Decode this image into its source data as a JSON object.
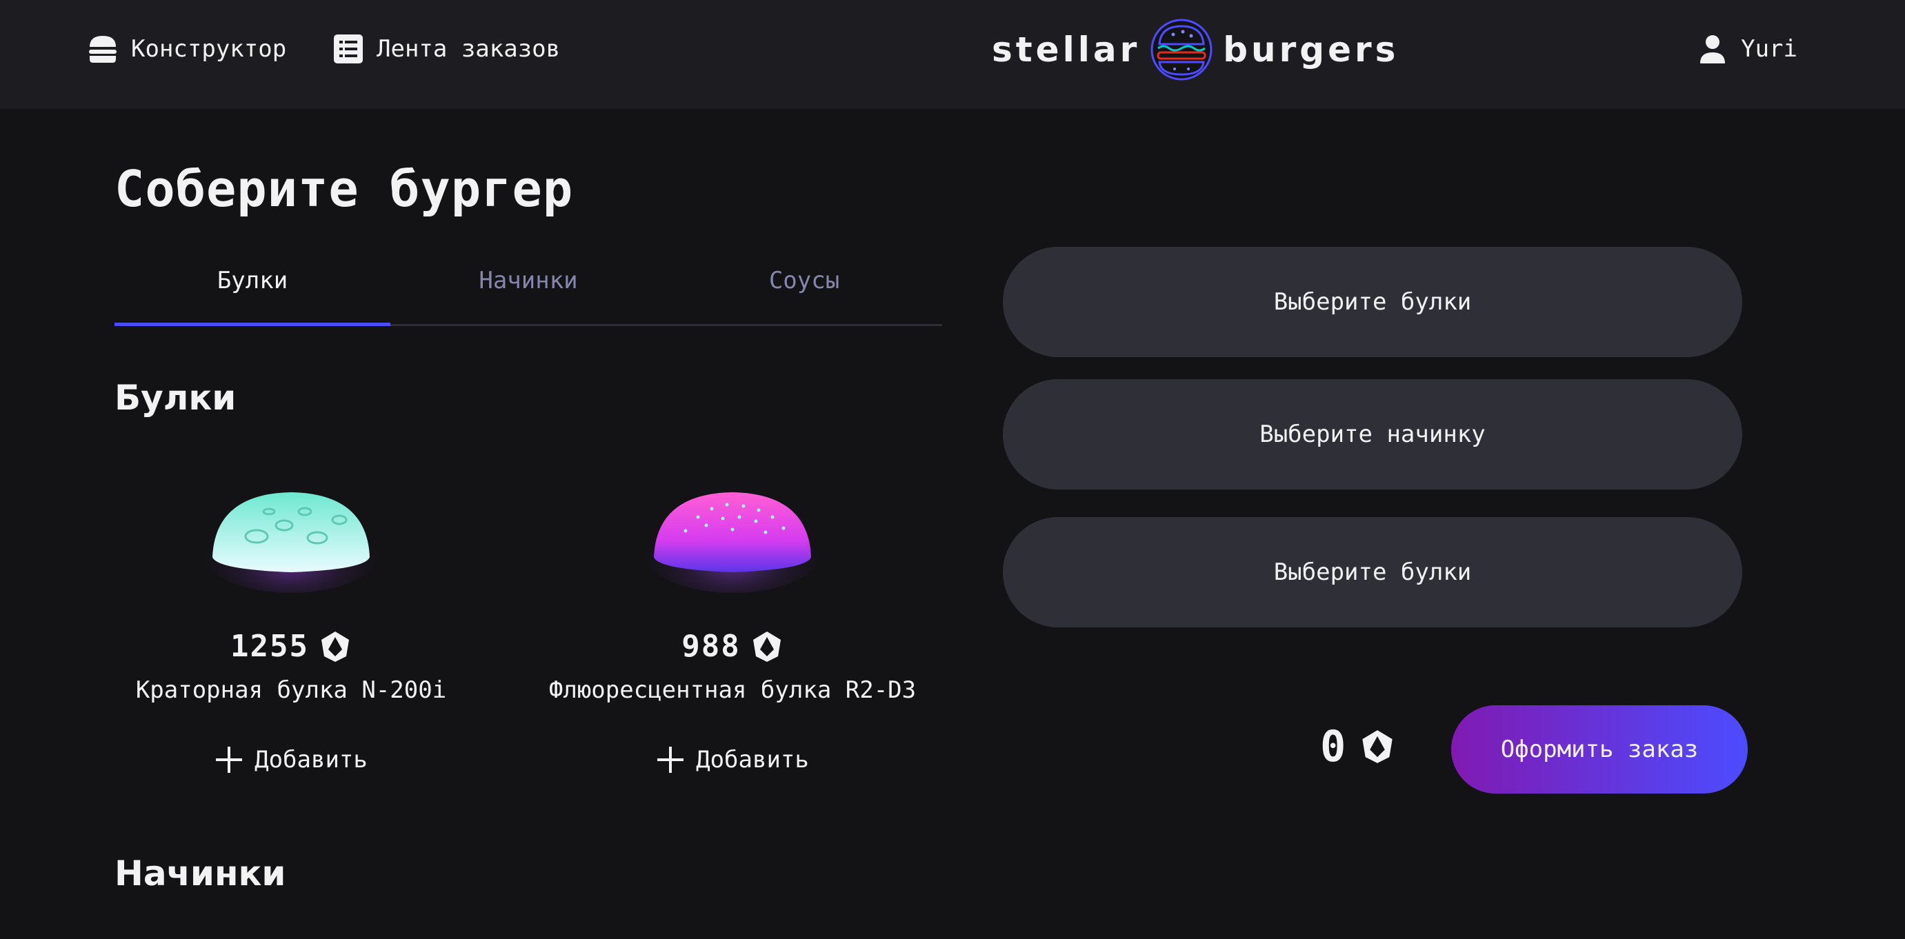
{
  "header": {
    "nav_constructor": "Конструктор",
    "nav_feed": "Лента заказов",
    "logo_left": "stellar",
    "logo_right": "burgers",
    "profile": "Yuri"
  },
  "main": {
    "title": "Соберите бургер",
    "tabs": [
      {
        "label": "Булки",
        "active": true
      },
      {
        "label": "Начинки",
        "active": false
      },
      {
        "label": "Соусы",
        "active": false
      }
    ],
    "sections": {
      "buns": "Булки",
      "fillings": "Начинки"
    },
    "products": [
      {
        "price": "1255",
        "name": "Краторная булка N-200i",
        "add_label": "Добавить",
        "icon": "bun-crater-icon"
      },
      {
        "price": "988",
        "name": "Флюоресцентная булка R2-D3",
        "add_label": "Добавить",
        "icon": "bun-fluorescent-icon"
      }
    ]
  },
  "constructor": {
    "slots": [
      {
        "label": "Выберите булки"
      },
      {
        "label": "Выберите начинку"
      },
      {
        "label": "Выберите булки"
      }
    ],
    "total": "0",
    "order_button": "Оформить заказ"
  },
  "colors": {
    "background": "#131316",
    "header": "#1c1c21",
    "slot": "#2f2f37",
    "accent": "#4c4cff",
    "inactive_text": "#8585ad"
  }
}
